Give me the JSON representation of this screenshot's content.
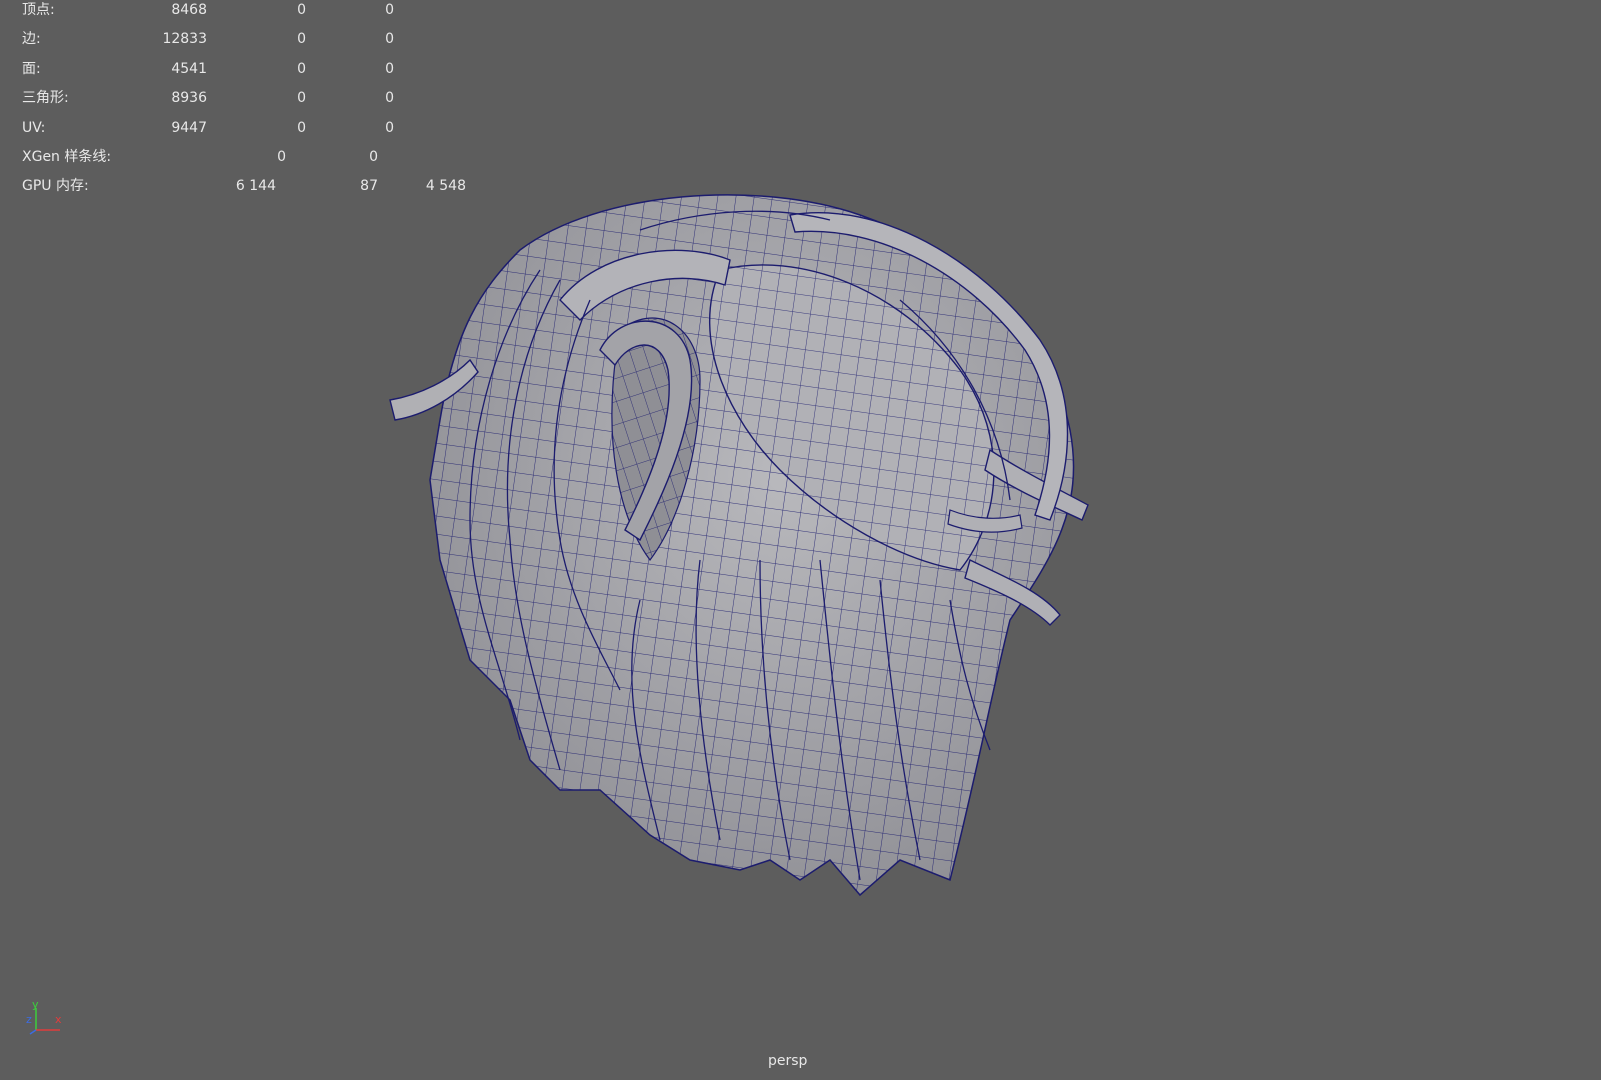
{
  "hud": {
    "rows": [
      {
        "label": "顶点:",
        "v1": "8468",
        "v2": "0",
        "v3": "0"
      },
      {
        "label": "边:",
        "v1": "12833",
        "v2": "0",
        "v3": "0"
      },
      {
        "label": "面:",
        "v1": "4541",
        "v2": "0",
        "v3": "0"
      },
      {
        "label": "三角形:",
        "v1": "8936",
        "v2": "0",
        "v3": "0"
      },
      {
        "label": "UV:",
        "v1": "9447",
        "v2": "0",
        "v3": "0"
      },
      {
        "label": "XGen 样条线:",
        "v1": "0",
        "v2": "0"
      },
      {
        "label": "GPU 内存:",
        "v1": "6 144",
        "v2": "87",
        "v3": "4 548"
      }
    ]
  },
  "camera": "persp",
  "axis": {
    "y": "y",
    "x": "x",
    "z": "z"
  },
  "colors": {
    "background": "#5d5d5d",
    "mesh_fill": "#a9a9ad",
    "wireframe": "#1c1c6e",
    "axis_x": "#e23c3c",
    "axis_y": "#3ccf3c",
    "axis_z": "#3c6ce2"
  }
}
